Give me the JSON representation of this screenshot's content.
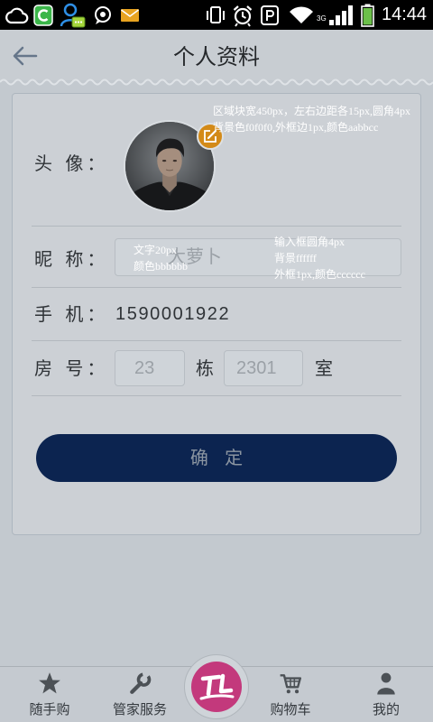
{
  "status_bar": {
    "time": "14:44",
    "network_type": "3G",
    "left_icons": [
      "cloud-icon",
      "shield-c-icon",
      "contacts-chat-icon",
      "chat-icon",
      "mail-icon"
    ],
    "right_icons": [
      "vibrate-icon",
      "alarm-icon",
      "p-box-icon",
      "wifi-icon",
      "signal-icon",
      "battery-icon"
    ]
  },
  "header": {
    "title": "个人资料",
    "back_icon": "back-arrow-icon"
  },
  "form": {
    "avatar": {
      "label": "头 像：",
      "edit_icon": "edit-icon"
    },
    "nickname": {
      "label": "昵 称：",
      "placeholder": "大萝卜"
    },
    "phone": {
      "label": "手 机：",
      "value": "1590001922"
    },
    "room": {
      "label": "房 号：",
      "building_placeholder": "23",
      "building_unit": "栋",
      "room_placeholder": "2301",
      "room_unit": "室"
    },
    "submit_label": "确 定"
  },
  "annotations": {
    "card": [
      "区域块宽450px，左右边距各15px,圆角4px",
      "背景色f0f0f0,外框边1px,颜色aabbcc"
    ],
    "text": [
      "文字20px",
      "颜色bbbbbb"
    ],
    "input": [
      "输入框圆角4px",
      "背景ffffff",
      "外框1px,颜色cccccc"
    ]
  },
  "bottom_nav": {
    "items": [
      {
        "label": "随手购",
        "icon": "star-icon"
      },
      {
        "label": "管家服务",
        "icon": "wrench-icon"
      },
      {
        "label": "购物车",
        "icon": "cart-icon"
      },
      {
        "label": "我的",
        "icon": "person-icon"
      }
    ],
    "center_icon": "home-logo-icon"
  },
  "colors": {
    "button_bg": "#0c2450",
    "edit_badge": "#d38a18",
    "logo": "#c3397c",
    "shield_green": "#3cb64a",
    "mail_orange": "#e8a320",
    "battery_green": "#6cc04a",
    "contacts_blue": "#2e8fe6",
    "annotation_text": "#ffffff"
  }
}
